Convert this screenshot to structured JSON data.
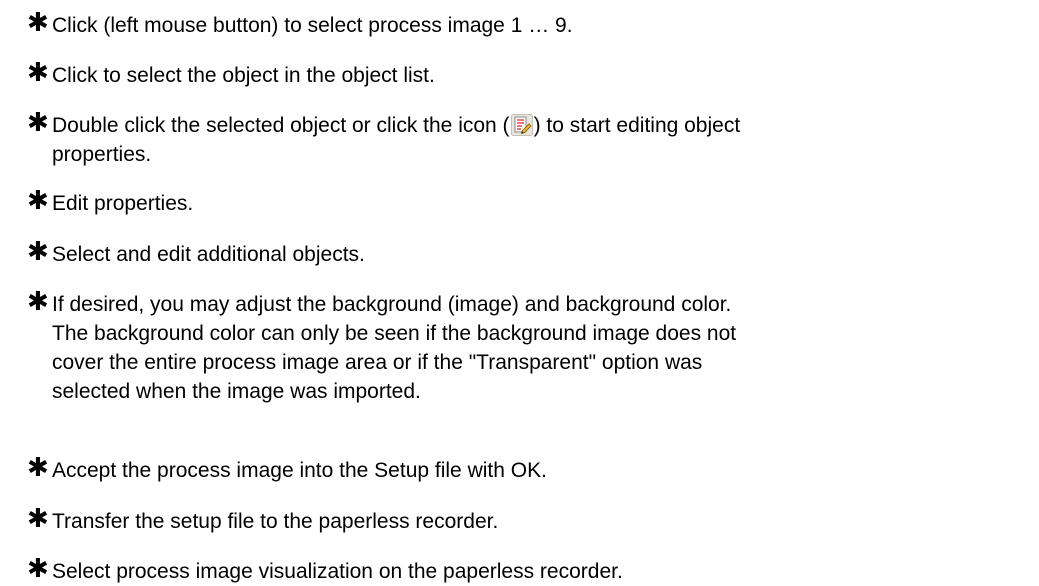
{
  "bullet_symbol": "✱",
  "steps": [
    {
      "lines": [
        "Click (left mouse button) to select process image 1 … 9."
      ]
    },
    {
      "lines": [
        "Click to select the object in the object list."
      ]
    },
    {
      "before_icon": "Double click the selected object or click the icon (",
      "icon": "edit-properties-icon",
      "after_icon": ") to start editing object",
      "lines": [
        "properties."
      ]
    },
    {
      "lines": [
        "Edit properties."
      ]
    },
    {
      "lines": [
        "Select and edit additional objects."
      ]
    },
    {
      "lines": [
        "If desired, you may adjust the background (image) and background color.",
        "The background color can only be seen if the background image does not",
        "cover the entire process image area or if the \"Transparent\" option was",
        "selected when the image was imported."
      ]
    },
    {
      "lines": [
        "Accept the process image into the Setup file with OK."
      ]
    },
    {
      "lines": [
        "Transfer the setup file to the paperless recorder."
      ]
    },
    {
      "lines": [
        "Select process image visualization on the paperless recorder."
      ]
    }
  ]
}
